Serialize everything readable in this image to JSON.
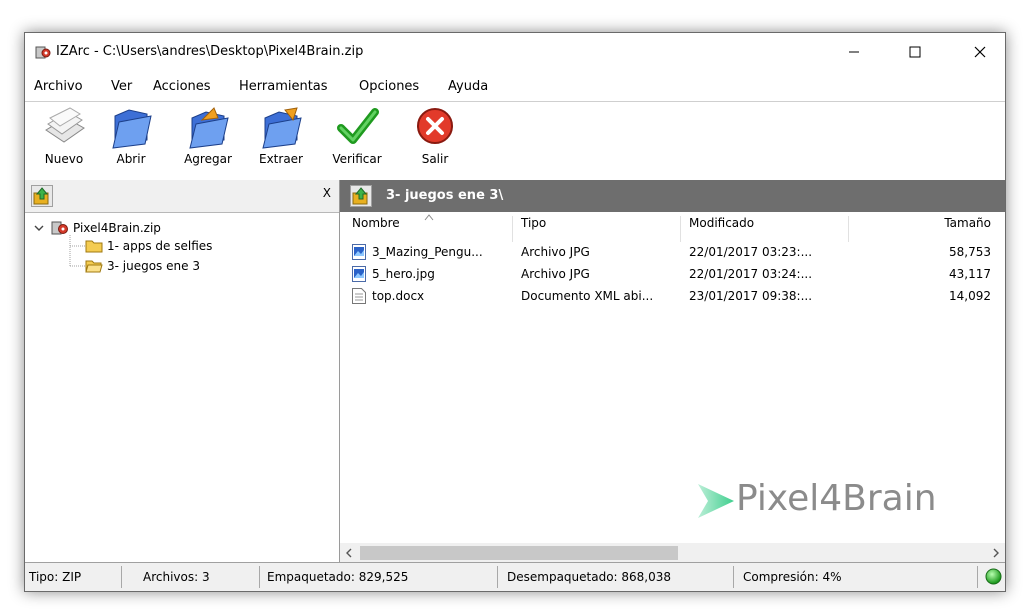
{
  "window": {
    "title": "IZArc - C:\\Users\\andres\\Desktop\\Pixel4Brain.zip"
  },
  "menu": [
    "Archivo",
    "Ver",
    "Acciones",
    "Herramientas",
    "Opciones",
    "Ayuda"
  ],
  "toolbar": {
    "nuevo": "Nuevo",
    "abrir": "Abrir",
    "agregar": "Agregar",
    "extraer": "Extraer",
    "verificar": "Verificar",
    "salir": "Salir"
  },
  "tree": {
    "close_label": "X",
    "root": "Pixel4Brain.zip",
    "children": [
      "1- apps de selfies",
      "3- juegos ene 3"
    ]
  },
  "filelist": {
    "path": "3- juegos ene 3\\",
    "columns": [
      "Nombre",
      "Tipo",
      "Modificado",
      "Tamaño"
    ],
    "rows": [
      {
        "name": "3_Mazing_Pengu...",
        "type": "Archivo JPG",
        "modified": "22/01/2017 03:23:...",
        "size": "58,753",
        "icon": "image-file-icon"
      },
      {
        "name": "5_hero.jpg",
        "type": "Archivo JPG",
        "modified": "22/01/2017 03:24:...",
        "size": "43,117",
        "icon": "image-file-icon"
      },
      {
        "name": "top.docx",
        "type": "Documento XML abi...",
        "modified": "23/01/2017 09:38:...",
        "size": "14,092",
        "icon": "document-file-icon"
      }
    ]
  },
  "statusbar": {
    "tipo": "Tipo: ZIP",
    "archivos": "Archivos: 3",
    "empaquetado": "Empaquetado: 829,525",
    "desempaquetado": "Desempaquetado: 868,038",
    "compresion": "Compresión: 4%"
  },
  "watermark": "Pixel4Brain",
  "colors": {
    "status_ok": "#2fbf2f",
    "path_bar": "#6e6e6e",
    "watermark_accent": "#3fcf8e"
  }
}
